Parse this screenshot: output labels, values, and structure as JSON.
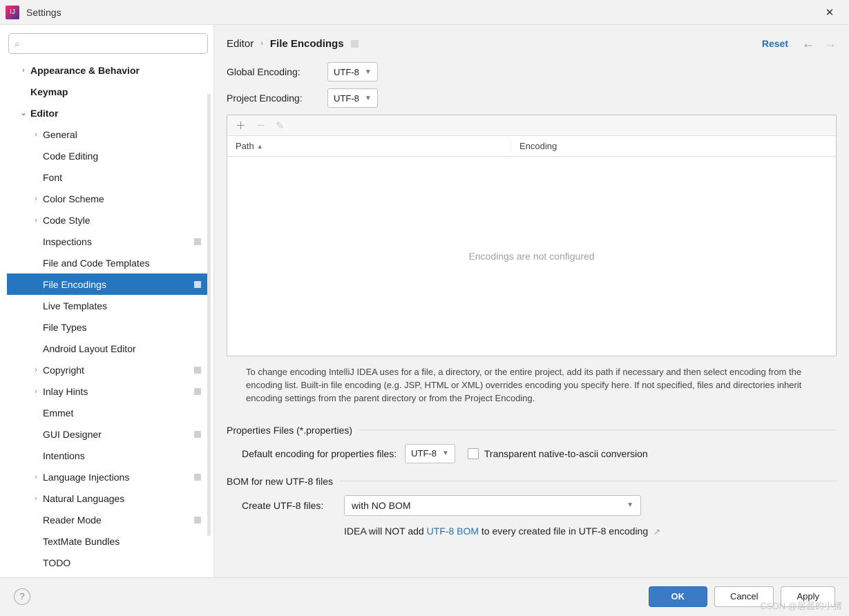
{
  "window": {
    "title": "Settings"
  },
  "breadcrumb": {
    "root": "Editor",
    "sep": "›",
    "leaf": "File Encodings",
    "reset": "Reset"
  },
  "sidebar": {
    "items": [
      {
        "label": "Appearance & Behavior",
        "bold": true,
        "indent": 0,
        "chevron": "›"
      },
      {
        "label": "Keymap",
        "bold": true,
        "indent": 0,
        "chevron": ""
      },
      {
        "label": "Editor",
        "bold": true,
        "indent": 0,
        "chevron": "⌄"
      },
      {
        "label": "General",
        "indent": 1,
        "chevron": "›"
      },
      {
        "label": "Code Editing",
        "indent": 1,
        "chevron": ""
      },
      {
        "label": "Font",
        "indent": 1,
        "chevron": ""
      },
      {
        "label": "Color Scheme",
        "indent": 1,
        "chevron": "›"
      },
      {
        "label": "Code Style",
        "indent": 1,
        "chevron": "›"
      },
      {
        "label": "Inspections",
        "indent": 1,
        "chevron": "",
        "badge": true
      },
      {
        "label": "File and Code Templates",
        "indent": 1,
        "chevron": ""
      },
      {
        "label": "File Encodings",
        "indent": 1,
        "chevron": "",
        "badge": true,
        "selected": true
      },
      {
        "label": "Live Templates",
        "indent": 1,
        "chevron": ""
      },
      {
        "label": "File Types",
        "indent": 1,
        "chevron": ""
      },
      {
        "label": "Android Layout Editor",
        "indent": 1,
        "chevron": ""
      },
      {
        "label": "Copyright",
        "indent": 1,
        "chevron": "›",
        "badge": true
      },
      {
        "label": "Inlay Hints",
        "indent": 1,
        "chevron": "›",
        "badge": true
      },
      {
        "label": "Emmet",
        "indent": 1,
        "chevron": ""
      },
      {
        "label": "GUI Designer",
        "indent": 1,
        "chevron": "",
        "badge": true
      },
      {
        "label": "Intentions",
        "indent": 1,
        "chevron": ""
      },
      {
        "label": "Language Injections",
        "indent": 1,
        "chevron": "›",
        "badge": true
      },
      {
        "label": "Natural Languages",
        "indent": 1,
        "chevron": "›"
      },
      {
        "label": "Reader Mode",
        "indent": 1,
        "chevron": "",
        "badge": true
      },
      {
        "label": "TextMate Bundles",
        "indent": 1,
        "chevron": ""
      },
      {
        "label": "TODO",
        "indent": 1,
        "chevron": ""
      }
    ]
  },
  "form": {
    "globalLabel": "Global Encoding:",
    "globalValue": "UTF-8",
    "projectLabel": "Project Encoding:",
    "projectValue": "UTF-8"
  },
  "table": {
    "colPath": "Path",
    "colEncoding": "Encoding",
    "empty": "Encodings are not configured"
  },
  "hint": "To change encoding IntelliJ IDEA uses for a file, a directory, or the entire project, add its path if necessary and then select encoding from the encoding list. Built-in file encoding (e.g. JSP, HTML or XML) overrides encoding you specify here. If not specified, files and directories inherit encoding settings from the parent directory or from the Project Encoding.",
  "properties": {
    "section": "Properties Files (*.properties)",
    "label": "Default encoding for properties files:",
    "value": "UTF-8",
    "checkbox": "Transparent native-to-ascii conversion"
  },
  "bom": {
    "section": "BOM for new UTF-8 files",
    "label": "Create UTF-8 files:",
    "value": "with NO BOM",
    "note_pre": "IDEA will NOT add ",
    "note_link": "UTF-8 BOM",
    "note_post": " to every created file in UTF-8 encoding"
  },
  "buttons": {
    "ok": "OK",
    "cancel": "Cancel",
    "apply": "Apply"
  },
  "watermark": "CSDN @居酱的小猪"
}
